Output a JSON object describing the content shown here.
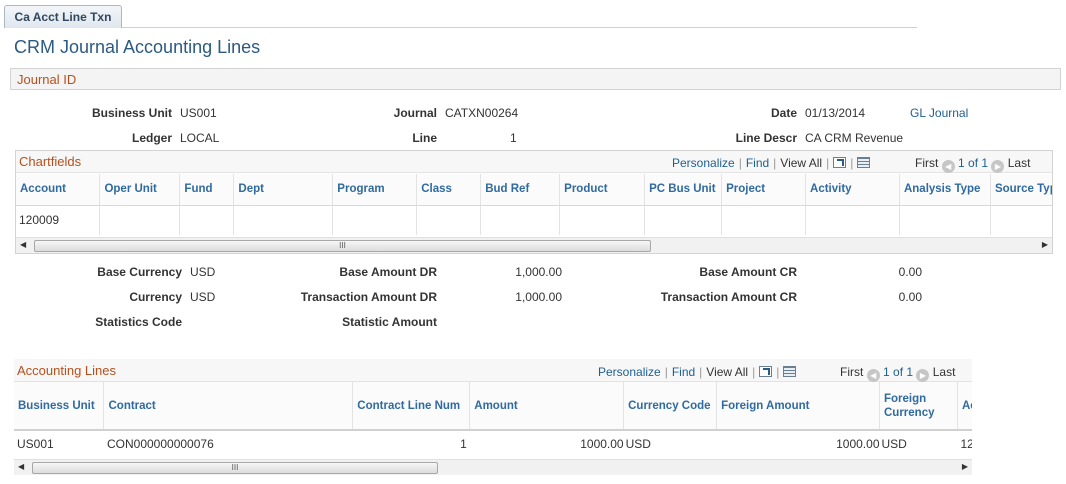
{
  "tab": {
    "label": "Ca Acct Line Txn"
  },
  "page": {
    "title": "CRM Journal Accounting Lines"
  },
  "journal_section": {
    "title": "Journal ID"
  },
  "header": {
    "business_unit": {
      "label": "Business Unit",
      "value": "US001"
    },
    "journal": {
      "label": "Journal",
      "value": "CATXN00264"
    },
    "date": {
      "label": "Date",
      "value": "01/13/2014"
    },
    "gl_journal_link": "GL Journal",
    "ledger": {
      "label": "Ledger",
      "value": "LOCAL"
    },
    "line": {
      "label": "Line",
      "value": "1"
    },
    "line_descr": {
      "label": "Line Descr",
      "value": "CA CRM Revenue"
    }
  },
  "chartfields": {
    "title": "Chartfields",
    "nav": {
      "personalize": "Personalize",
      "find": "Find",
      "view_all": "View All",
      "first": "First",
      "range": "1 of 1",
      "last": "Last"
    },
    "columns": [
      "Account",
      "Oper Unit",
      "Fund",
      "Dept",
      "Program",
      "Class",
      "Bud Ref",
      "Product",
      "PC Bus Unit",
      "Project",
      "Activity",
      "Analysis Type",
      "Source Typ"
    ],
    "rows": [
      [
        "120009",
        "",
        "",
        "",
        "",
        "",
        "",
        "",
        "",
        "",
        "",
        "",
        ""
      ]
    ],
    "scroll_grip": "III"
  },
  "amounts": {
    "base_currency": {
      "label": "Base Currency",
      "value": "USD"
    },
    "base_amount_dr": {
      "label": "Base Amount DR",
      "value": "1,000.00"
    },
    "base_amount_cr": {
      "label": "Base Amount CR",
      "value": "0.00"
    },
    "currency": {
      "label": "Currency",
      "value": "USD"
    },
    "transaction_amount_dr": {
      "label": "Transaction Amount DR",
      "value": "1,000.00"
    },
    "transaction_amount_cr": {
      "label": "Transaction Amount CR",
      "value": "0.00"
    },
    "statistics_code": {
      "label": "Statistics Code",
      "value": ""
    },
    "statistic_amount": {
      "label": "Statistic Amount",
      "value": ""
    }
  },
  "accounting_lines": {
    "title": "Accounting Lines",
    "nav": {
      "personalize": "Personalize",
      "find": "Find",
      "view_all": "View All",
      "first": "First",
      "range": "1 of 1",
      "last": "Last"
    },
    "columns": [
      "Business Unit",
      "Contract",
      "Contract Line Num",
      "Amount",
      "Currency Code",
      "Foreign Amount",
      "Foreign\nCurrency",
      "Ac"
    ],
    "rows": [
      [
        "US001",
        "CON000000000076",
        "1",
        "1000.00",
        "USD",
        "1000.00",
        "USD",
        "12"
      ]
    ],
    "scroll_grip": "III"
  },
  "colors": {
    "link": "#1e5f93",
    "section_title": "#b5501c",
    "page_title": "#2b5a82",
    "column_header": "#2f6aa0"
  }
}
